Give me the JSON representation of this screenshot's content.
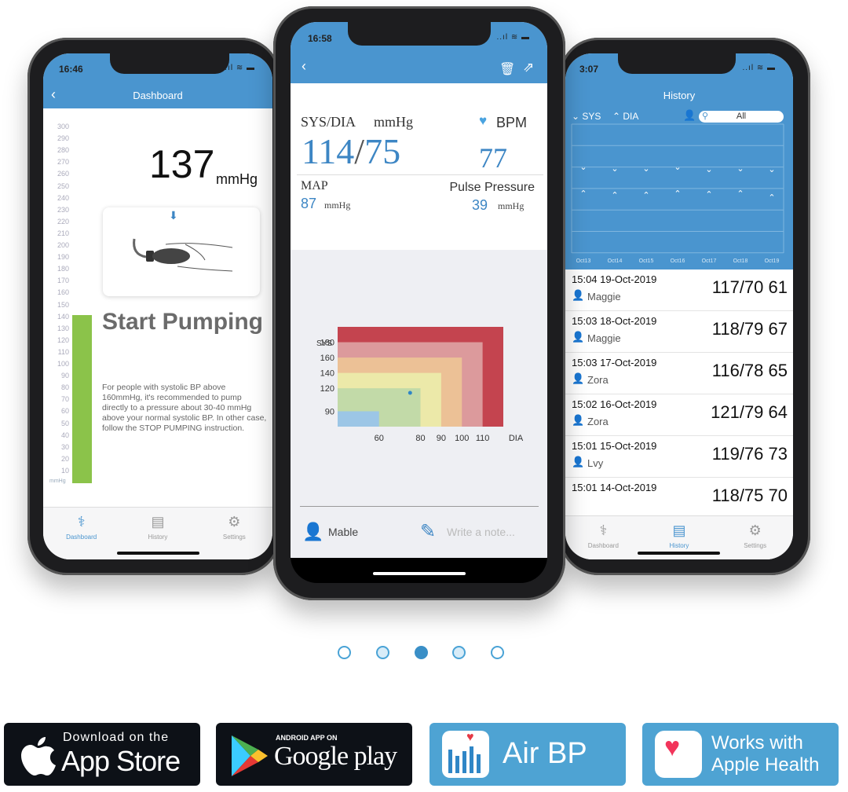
{
  "left_phone": {
    "time": "16:46",
    "status": "..ıl ≋ ▬",
    "title": "Dashboard",
    "scale": [
      "300",
      "290",
      "280",
      "270",
      "260",
      "250",
      "240",
      "230",
      "220",
      "210",
      "200",
      "190",
      "180",
      "170",
      "160",
      "150",
      "140",
      "130",
      "120",
      "110",
      "100",
      "90",
      "80",
      "70",
      "60",
      "50",
      "40",
      "30",
      "20",
      "10"
    ],
    "scale_unit": "mmHg",
    "pressure": "137",
    "pressure_unit": "mmHg",
    "gauge_level_mmHg": 137,
    "gauge_color": "#8bc34a",
    "heading": "Start Pumping",
    "instruction": "For people with systolic BP above 160mmHg, it's recommended to pump directly to a pressure about 30-40 mmHg above your normal systolic BP. In other case, follow the STOP PUMPING instruction.",
    "tabs": [
      {
        "label": "Dashboard",
        "icon": "stethoscope-icon"
      },
      {
        "label": "History",
        "icon": "chart-icon"
      },
      {
        "label": "Settings",
        "icon": "gear-icon"
      }
    ],
    "active_tab": 0
  },
  "center_phone": {
    "time": "16:58",
    "status": "..ıl ≋ ▬",
    "sysdia_label": "SYS/DIA",
    "sysdia_unit": "mmHg",
    "sys": "114",
    "dia": "75",
    "slash": "/",
    "bpm_label": "BPM",
    "bpm": "77",
    "map_label": "MAP",
    "map": "87",
    "map_unit": "mmHg",
    "pp_label": "Pulse Pressure",
    "pp": "39",
    "pp_unit": "mmHg",
    "chart": {
      "y_label": "SYS",
      "x_label": "DIA",
      "y_ticks": [
        "180",
        "160",
        "140",
        "120",
        "90"
      ],
      "x_ticks": [
        "60",
        "80",
        "90",
        "100",
        "110"
      ],
      "zones": [
        {
          "dia": 120,
          "sys": 200,
          "color": "#c4444f"
        },
        {
          "dia": 110,
          "sys": 180,
          "color": "#dc9a9c"
        },
        {
          "dia": 100,
          "sys": 160,
          "color": "#ecc196"
        },
        {
          "dia": 90,
          "sys": 140,
          "color": "#ece9a9"
        },
        {
          "dia": 80,
          "sys": 120,
          "color": "#c2daa8"
        },
        {
          "dia": 60,
          "sys": 90,
          "color": "#9cc6e6"
        }
      ],
      "reading": {
        "dia": 75,
        "sys": 114
      }
    },
    "user": "Mable",
    "note_placeholder": "Write a note..."
  },
  "right_phone": {
    "time": "3:07",
    "status": "..ıl ≋ ▬",
    "title": "History",
    "sys_filter": "SYS",
    "dia_filter": "DIA",
    "search_value": "All",
    "dates": [
      "Oct13",
      "Oct14",
      "Oct15",
      "Oct16",
      "Oct17",
      "Oct18",
      "Oct19"
    ],
    "records": [
      {
        "datetime": "15:04 19-Oct-2019",
        "user": "Maggie",
        "value": "117/70 61"
      },
      {
        "datetime": "15:03 18-Oct-2019",
        "user": "Maggie",
        "value": "118/79 67"
      },
      {
        "datetime": "15:03 17-Oct-2019",
        "user": "Zora",
        "value": "116/78 65"
      },
      {
        "datetime": "15:02 16-Oct-2019",
        "user": "Zora",
        "value": "121/79 64"
      },
      {
        "datetime": "15:01 15-Oct-2019",
        "user": "Lvy",
        "value": "119/76 73"
      },
      {
        "datetime": "15:01 14-Oct-2019",
        "user": "",
        "value": "118/75 70"
      }
    ],
    "tabs": [
      {
        "label": "Dashboard",
        "icon": "stethoscope-icon"
      },
      {
        "label": "History",
        "icon": "chart-icon"
      },
      {
        "label": "Settings",
        "icon": "gear-icon"
      }
    ],
    "active_tab": 1
  },
  "pagination": {
    "count": 5,
    "active": 2
  },
  "badges": {
    "appstore": {
      "small": "Download on the",
      "big": "App Store"
    },
    "googleplay": {
      "small": "ANDROID APP ON",
      "big": "Google play"
    },
    "airbp": {
      "label": "Air BP"
    },
    "applehealth": {
      "line1": "Works with",
      "line2": "Apple Health"
    }
  },
  "colors": {
    "accent": "#4a95cf",
    "badge_blue": "#4ea3d3",
    "badge_dark": "#0d1117"
  }
}
